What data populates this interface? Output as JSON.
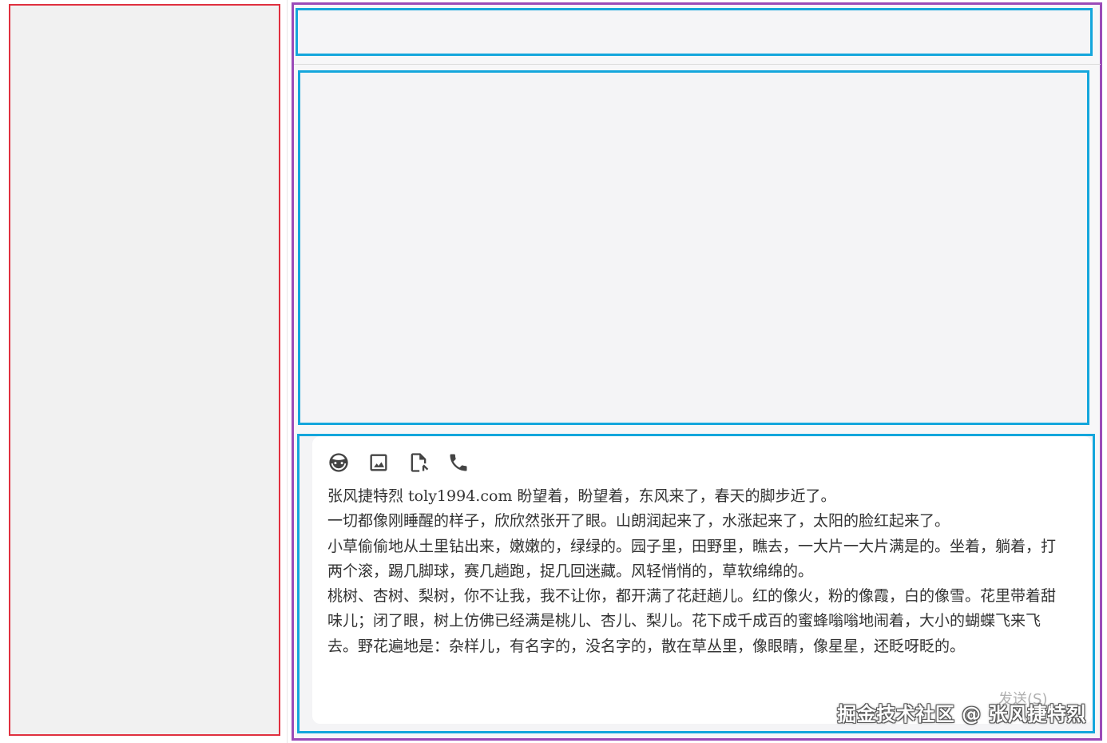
{
  "toolbar": {
    "icons": [
      "emoji-icon",
      "image-icon",
      "file-icon",
      "phone-icon"
    ]
  },
  "editor": {
    "paragraphs": [
      "张风捷特烈 toly1994.com 盼望着，盼望着，东风来了，春天的脚步近了。",
      "一切都像刚睡醒的样子，欣欣然张开了眼。山朗润起来了，水涨起来了，太阳的脸红起来了。",
      "小草偷偷地从土里钻出来，嫩嫩的，绿绿的。园子里，田野里，瞧去，一大片一大片满是的。坐着，躺着，打两个滚，踢几脚球，赛几趟跑，捉几回迷藏。风轻悄悄的，草软绵绵的。",
      "桃树、杏树、梨树，你不让我，我不让你，都开满了花赶趟儿。红的像火，粉的像霞，白的像雪。花里带着甜味儿；闭了眼，树上仿佛已经满是桃儿、杏儿、梨儿。花下成千成百的蜜蜂嗡嗡地闹着，大小的蝴蝶飞来飞去。野花遍地是：杂样儿，有名字的，没名字的，散在草丛里，像眼睛，像星星，还眨呀眨的。"
    ]
  },
  "send_label": "发送(S)",
  "watermark": "掘金技术社区 @ 张风捷特烈",
  "colors": {
    "left_frame": "#e0303f",
    "right_frame": "#9b4bb8",
    "section_frame": "#14a6dc"
  }
}
